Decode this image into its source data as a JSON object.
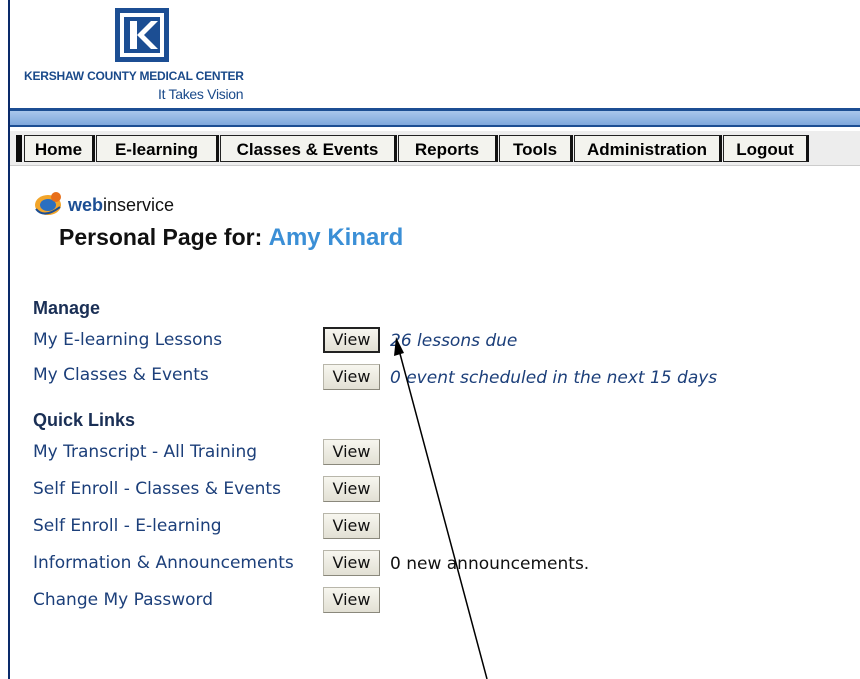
{
  "header": {
    "organization": "KERSHAW COUNTY MEDICAL CENTER",
    "tagline": "It Takes Vision",
    "colors": {
      "brand_blue": "#1c4e93",
      "accent_blue": "#3b8fd6"
    }
  },
  "nav": {
    "items": [
      {
        "label": "Home"
      },
      {
        "label": "E-learning"
      },
      {
        "label": "Classes & Events"
      },
      {
        "label": "Reports"
      },
      {
        "label": "Tools"
      },
      {
        "label": "Administration"
      },
      {
        "label": "Logout"
      }
    ]
  },
  "brand": {
    "prefix": "web",
    "suffix": "inservice"
  },
  "page": {
    "title_prefix": "Personal Page for:",
    "user_name": "Amy Kinard"
  },
  "manage": {
    "heading": "Manage",
    "rows": [
      {
        "label": "My E-learning Lessons",
        "button": "View",
        "info": "26 lessons due"
      },
      {
        "label": "My Classes & Events",
        "button": "View",
        "info": "0 event scheduled in the next 15 days"
      }
    ]
  },
  "quick_links": {
    "heading": "Quick Links",
    "rows": [
      {
        "label": "My Transcript - All Training",
        "button": "View"
      },
      {
        "label": "Self Enroll - Classes & Events",
        "button": "View"
      },
      {
        "label": "Self Enroll - E-learning",
        "button": "View"
      },
      {
        "label": "Information & Announcements",
        "button": "View",
        "info": "0 new announcements."
      },
      {
        "label": "Change My Password",
        "button": "View"
      }
    ]
  }
}
